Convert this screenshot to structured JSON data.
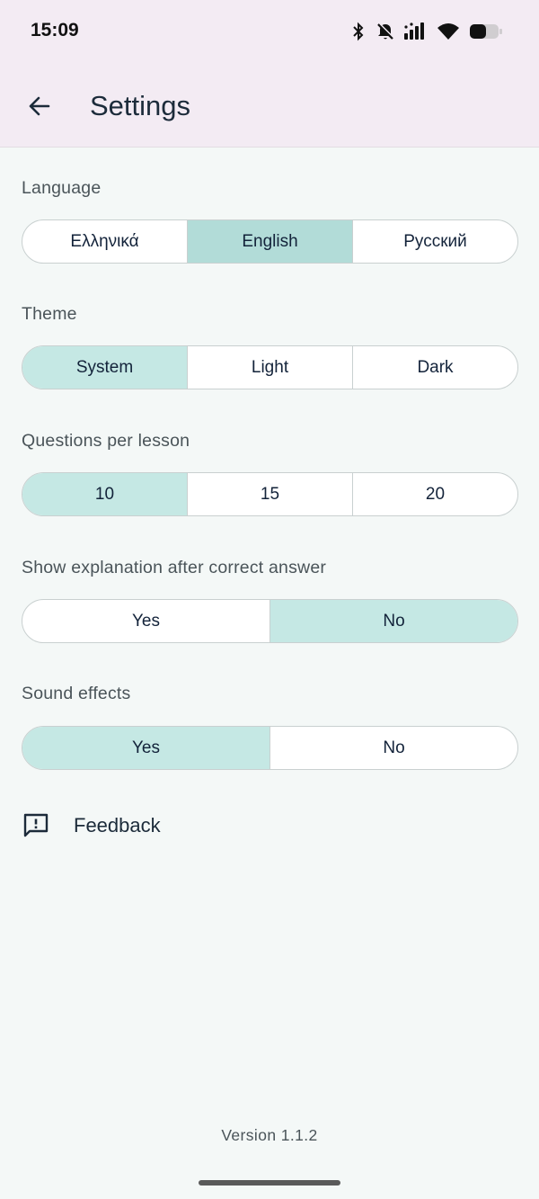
{
  "status_bar": {
    "time": "15:09",
    "icons": [
      "bluetooth-icon",
      "mute-icon",
      "signal-icon",
      "wifi-icon",
      "battery-icon"
    ]
  },
  "header": {
    "back_icon": "arrow-left-icon",
    "title": "Settings"
  },
  "settings": {
    "language": {
      "label": "Language",
      "options": [
        "Ελληνικά",
        "English",
        "Русский"
      ],
      "selected": "English"
    },
    "theme": {
      "label": "Theme",
      "options": [
        "System",
        "Light",
        "Dark"
      ],
      "selected": "System"
    },
    "questions_per_lesson": {
      "label": "Questions per lesson",
      "options": [
        "10",
        "15",
        "20"
      ],
      "selected": "10"
    },
    "show_explanation": {
      "label": "Show explanation after correct answer",
      "options": [
        "Yes",
        "No"
      ],
      "selected": "No"
    },
    "sound_effects": {
      "label": "Sound effects",
      "options": [
        "Yes",
        "No"
      ],
      "selected": "Yes"
    }
  },
  "feedback": {
    "icon": "feedback-icon",
    "label": "Feedback"
  },
  "footer": {
    "version": "Version 1.1.2"
  },
  "colors": {
    "top_bar": "#f3ebf3",
    "background": "#f4f8f7",
    "selected_segment": "#c5e8e4",
    "border": "#c9d0d0"
  }
}
